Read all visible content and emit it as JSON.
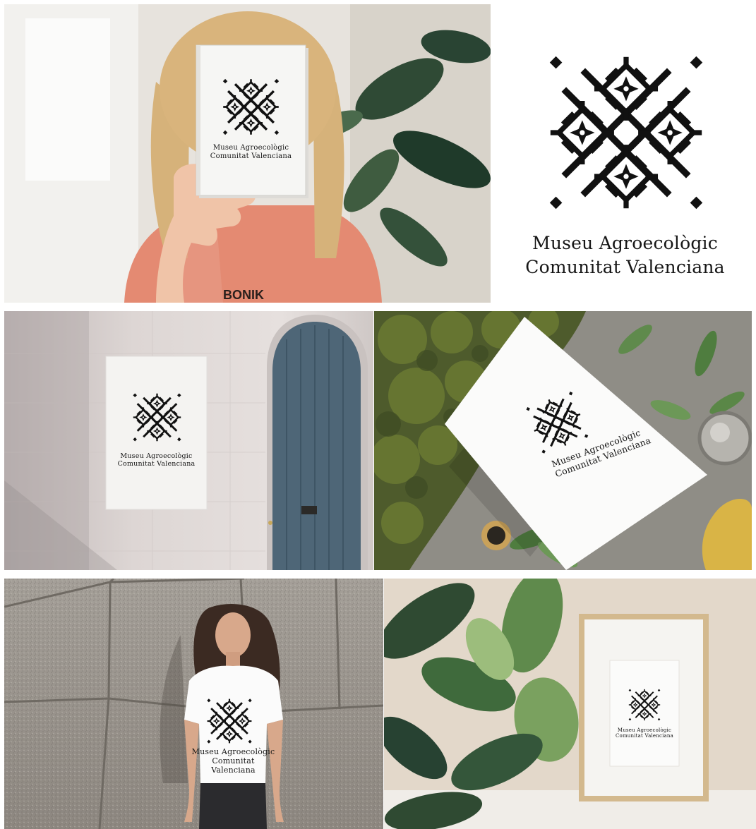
{
  "brand": {
    "line1": "Museu Agroecològic",
    "line2": "Comunitat Valenciana"
  },
  "tshirt_text": "BONIK",
  "icons": [
    "logo-mark-icon"
  ],
  "colors": {
    "logo": "#111111",
    "paper": "#f6f6f4",
    "background": "#ffffff"
  }
}
